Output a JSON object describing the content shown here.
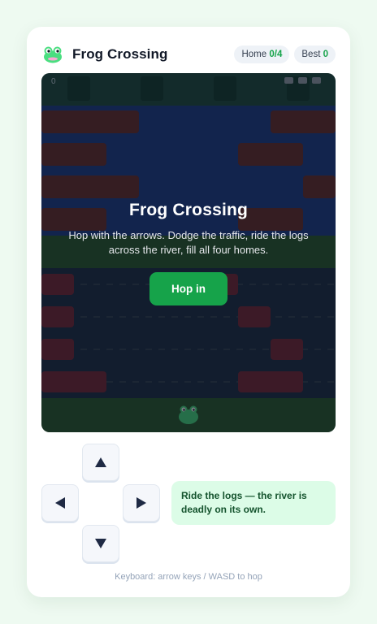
{
  "header": {
    "title": "Frog Crossing",
    "home_label": "Home",
    "home_value": "0/4",
    "best_label": "Best",
    "best_value": "0"
  },
  "board": {
    "score_text": "0",
    "lives": 3,
    "overlay": {
      "title": "Frog Crossing",
      "text": "Hop with the arrows. Dodge the traffic, ride the logs across the river, fill all four homes.",
      "button_label": "Hop in"
    }
  },
  "controls": {
    "up_icon": "arrow-up-icon",
    "left_icon": "arrow-left-icon",
    "right_icon": "arrow-right-icon",
    "down_icon": "arrow-down-icon"
  },
  "tip": "Ride the logs — the river is deadly on its own.",
  "hint": "Keyboard: arrow keys / WASD to hop",
  "colors": {
    "accent": "#16a34a",
    "river": "#1d3a8a",
    "road": "#1e2a45",
    "grass": "#2b5a2e",
    "log": "#6b2a2a",
    "car": "#7a2537"
  }
}
